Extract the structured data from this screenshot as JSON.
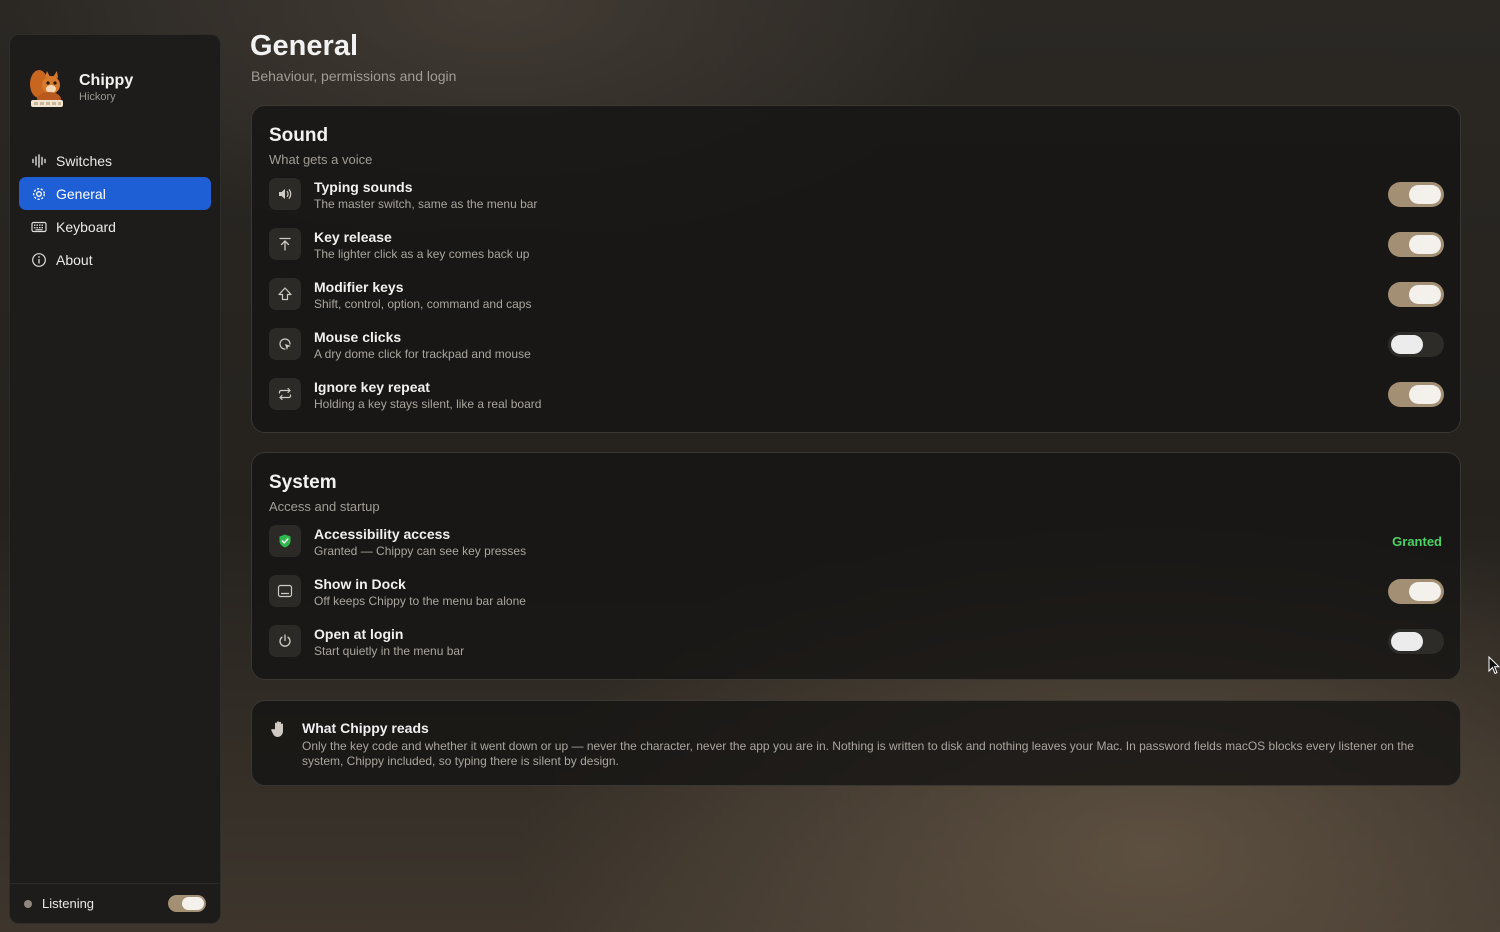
{
  "app": {
    "name": "Chippy",
    "subtitle": "Hickory"
  },
  "sidebar": {
    "items": [
      {
        "label": "Switches",
        "icon": "waveform-icon",
        "active": false
      },
      {
        "label": "General",
        "icon": "gear-icon",
        "active": true
      },
      {
        "label": "Keyboard",
        "icon": "keyboard-icon",
        "active": false
      },
      {
        "label": "About",
        "icon": "info-icon",
        "active": false
      }
    ],
    "listening": {
      "label": "Listening",
      "on": true
    }
  },
  "page": {
    "title": "General",
    "subtitle": "Behaviour, permissions and login"
  },
  "sound": {
    "title": "Sound",
    "subtitle": "What gets a voice",
    "rows": [
      {
        "title": "Typing sounds",
        "subtitle": "The master switch, same as the menu bar",
        "icon": "speaker-icon",
        "on": true
      },
      {
        "title": "Key release",
        "subtitle": "The lighter click as a key comes back up",
        "icon": "arrow-up-to-line-icon",
        "on": true
      },
      {
        "title": "Modifier keys",
        "subtitle": "Shift, control, option, command and caps",
        "icon": "shift-icon",
        "on": true
      },
      {
        "title": "Mouse clicks",
        "subtitle": "A dry dome click for trackpad and mouse",
        "icon": "cursor-click-icon",
        "on": false
      },
      {
        "title": "Ignore key repeat",
        "subtitle": "Holding a key stays silent, like a real board",
        "icon": "repeat-icon",
        "on": true
      }
    ]
  },
  "system": {
    "title": "System",
    "subtitle": "Access and startup",
    "rows": [
      {
        "title": "Accessibility access",
        "subtitle": "Granted — Chippy can see key presses",
        "icon": "shield-check-icon",
        "status": "Granted"
      },
      {
        "title": "Show in Dock",
        "subtitle": "Off keeps Chippy to the menu bar alone",
        "icon": "dock-icon",
        "on": true
      },
      {
        "title": "Open at login",
        "subtitle": "Start quietly in the menu bar",
        "icon": "power-icon",
        "on": false
      }
    ]
  },
  "privacy": {
    "title": "What Chippy reads",
    "body": "Only the key code and whether it went down or up — never the character, never the app you are in. Nothing is written to disk and nothing leaves your Mac. In password fields macOS blocks every listener on the system, Chippy included, so typing there is silent by design.",
    "icon": "hand-icon"
  },
  "colors": {
    "accent": "#1f5fd6",
    "toggle_on": "#a38f74",
    "granted": "#4cd264"
  }
}
